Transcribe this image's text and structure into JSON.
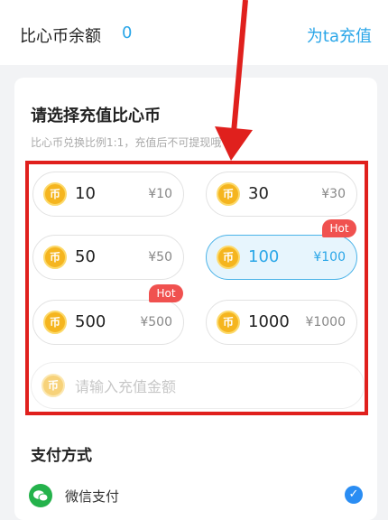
{
  "header": {
    "balance_label": "比心币余额",
    "balance_value": "0",
    "topup_link": "为ta充值"
  },
  "recharge": {
    "title": "请选择充值比心币",
    "hint": "比心币兑换比例1:1，充值后不可提现哦",
    "coin_icon_text": "币",
    "options": [
      {
        "amount": "10",
        "price": "¥10",
        "hot": false,
        "selected": false
      },
      {
        "amount": "30",
        "price": "¥30",
        "hot": false,
        "selected": false
      },
      {
        "amount": "50",
        "price": "¥50",
        "hot": false,
        "selected": false
      },
      {
        "amount": "100",
        "price": "¥100",
        "hot": true,
        "selected": true
      },
      {
        "amount": "500",
        "price": "¥500",
        "hot": true,
        "selected": false
      },
      {
        "amount": "1000",
        "price": "¥1000",
        "hot": false,
        "selected": false
      }
    ],
    "hot_label": "Hot",
    "custom_placeholder": "请输入充值金额"
  },
  "payment": {
    "title": "支付方式",
    "method_label": "微信支付",
    "method_icon": "wechat-icon",
    "selected": true
  },
  "colors": {
    "accent": "#2aa6e8",
    "annotation": "#e0201d",
    "hot_badge": "#f0514f"
  }
}
